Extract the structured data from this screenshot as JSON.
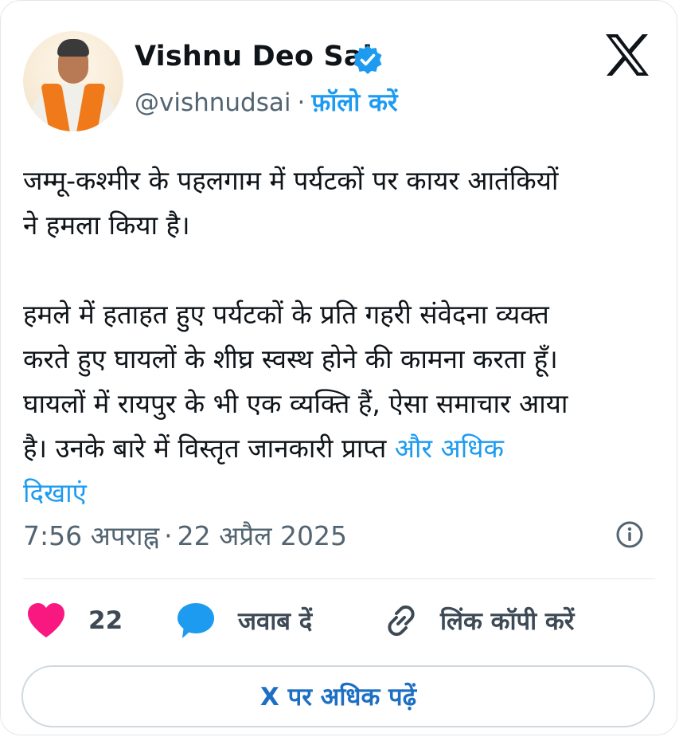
{
  "author": {
    "name": "Vishnu Deo Sai",
    "handle": "@vishnudsai",
    "separator": "·",
    "follow_label": "फ़ॉलो करें"
  },
  "tweet": {
    "line1": "जम्मू-कश्मीर के पहलगाम में पर्यटकों पर कायर आतंकियों",
    "line2": "ने हमला किया है।",
    "line3": "हमले में हताहत हुए पर्यटकों के प्रति गहरी संवेदना व्यक्त",
    "line4": "करते हुए घायलों के शीघ्र स्वस्थ होने की कामना करता हूँ।",
    "line5": "घायलों में रायपुर के भी एक व्यक्ति हैं, ऐसा समाचार आया",
    "line6": "है। उनके बारे में विस्तृत जानकारी प्राप्त",
    "show_more_1": "और अधिक",
    "show_more_2": "दिखाएं"
  },
  "meta": {
    "time": "7:56 अपराह्न",
    "separator": "·",
    "date": "22 अप्रैल 2025"
  },
  "actions": {
    "like_count": "22",
    "reply_label": "जवाब दें",
    "copy_link_label": "लिंक कॉपी करें"
  },
  "read_more_label": "X पर अधिक पढ़ें",
  "icons": {
    "verified": "verified-badge-icon",
    "brand": "x-logo-icon",
    "info": "info-icon",
    "like": "heart-icon",
    "reply": "reply-bubble-icon",
    "link": "link-icon"
  },
  "colors": {
    "accent": "#1d9bf0",
    "like": "#f91880",
    "muted_text": "#536471"
  }
}
